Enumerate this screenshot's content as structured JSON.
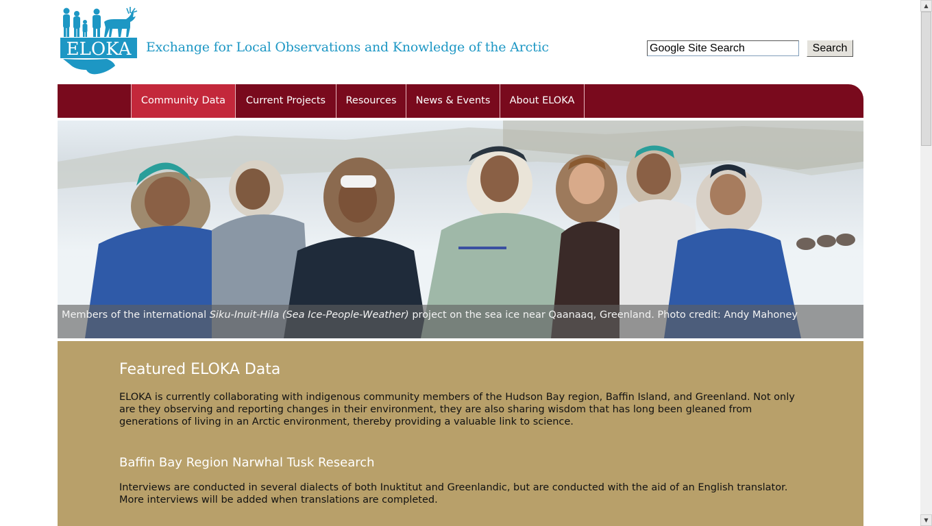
{
  "header": {
    "logo_text": "ELOKA",
    "tagline": "Exchange for Local Observations and Knowledge of the Arctic",
    "search_value": "Google Site Search",
    "search_button": "Search"
  },
  "nav": {
    "items": [
      {
        "label": "Community Data",
        "active": true
      },
      {
        "label": "Current Projects",
        "active": false
      },
      {
        "label": "Resources",
        "active": false
      },
      {
        "label": "News & Events",
        "active": false
      },
      {
        "label": "About ELOKA",
        "active": false
      }
    ]
  },
  "hero": {
    "caption_before": "Members of the international ",
    "caption_italic": "Siku-Inuit-Hila (Sea Ice-People-Weather)",
    "caption_after": " project on the sea ice near Qaanaaq, Greenland. Photo credit: Andy Mahoney"
  },
  "featured": {
    "title": "Featured ELOKA Data",
    "intro": "ELOKA is currently collaborating with indigenous community members of the Hudson Bay region, Baffin Island, and Greenland. Not only are they observing and reporting changes in their environment, they are also sharing wisdom that has long been gleaned from generations of living in an Arctic environment, thereby providing a valuable link to science.",
    "subtitle": "Baffin Bay Region Narwhal Tusk Research",
    "sub_text": "Interviews are conducted in several dialects of both Inuktitut and Greenlandic, but are conducted with the aid of an English translator. More interviews will be added when translations are completed."
  },
  "colors": {
    "nav_bg": "#790a1d",
    "nav_active": "#c3283b",
    "content_bg": "#b8a06a",
    "brand_blue": "#1d97c4"
  }
}
